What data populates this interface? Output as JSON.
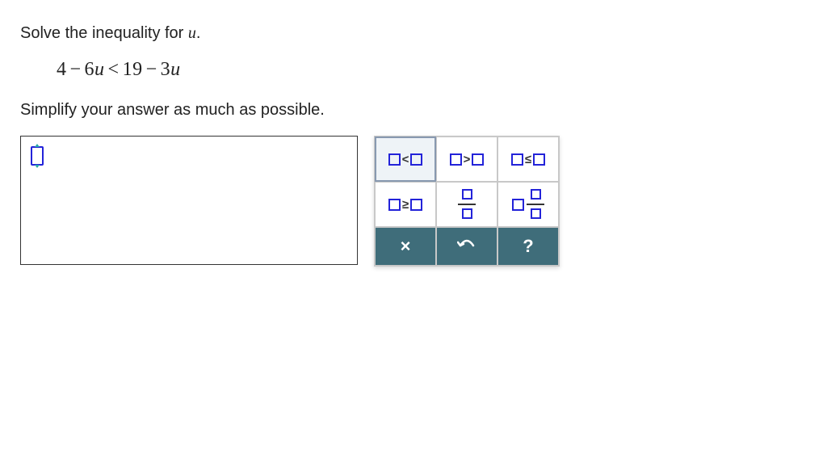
{
  "problem": {
    "instruction_prefix": "Solve the inequality for ",
    "variable": "u",
    "instruction_suffix": ".",
    "equation": {
      "lhs_const": "4",
      "lhs_coef": "6",
      "lhs_var": "u",
      "relation": "<",
      "rhs_const": "19",
      "rhs_coef": "3",
      "rhs_var": "u"
    },
    "sub_instruction": "Simplify your answer as much as possible."
  },
  "palette": {
    "ops": {
      "lt": "<",
      "gt": ">",
      "le": "≤",
      "ge": "≥"
    },
    "actions": {
      "clear": "×",
      "undo": "↶",
      "help": "?"
    }
  }
}
